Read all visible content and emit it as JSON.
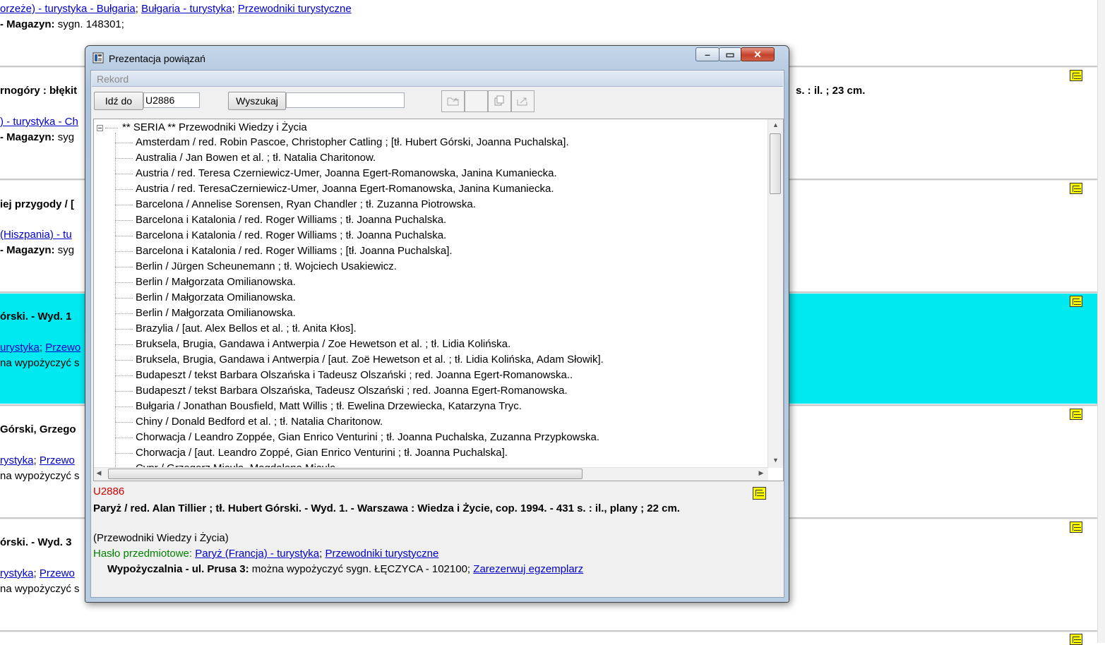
{
  "background": {
    "rows": [
      {
        "links": [
          "orzeże) - turystyka - Bułgaria",
          "Bułgaria - turystyka",
          "Przewodniki turystyczne"
        ],
        "holdings_label": "- Magazyn:",
        "holdings_value": "sygn. 148301;"
      },
      {
        "title": "rnogóry : błękit",
        "title_right": "s. : il. ; 23 cm.",
        "link": ") - turystyka - Ch",
        "holdings_label": "- Magazyn:",
        "holdings_value": "syg"
      },
      {
        "title": "iej przygody / [",
        "link": "(Hiszpania) - tu",
        "holdings_label": "- Magazyn:",
        "holdings_value": "syg"
      },
      {
        "title": "órski. - Wyd. 1",
        "link1": "urystyka",
        "link2": "Przewo",
        "avail": "na wypożyczyć s"
      },
      {
        "title": "Górski, Grzego",
        "link1": "rystyka",
        "link2": "Przewo",
        "avail": "na wypożyczyć s"
      },
      {
        "title": "órski. - Wyd. 3",
        "link1": "rystyka",
        "link2": "Przewo",
        "avail": "na wypożyczyć s"
      }
    ]
  },
  "dialog": {
    "title": "Prezentacja powiązań",
    "section_header": "Rekord",
    "goto_button": "Idź do",
    "goto_value": "U2886",
    "search_button": "Wyszukaj",
    "search_value": "",
    "tree_root": "** SERIA ** Przewodniki Wiedzy i Życia",
    "tree_items": [
      "Amsterdam / red. Robin Pascoe, Christopher Catling ; [tł. Hubert Górski, Joanna Puchalska].",
      "Australia / Jan Bowen et al. ; tł. Natalia Charitonow.",
      "Austria / red. Teresa Czerniewicz-Umer, Joanna Egert-Romanowska, Janina Kumaniecka.",
      "Austria / red. TeresaCzerniewicz-Umer, Joanna Egert-Romanowska, Janina Kumaniecka.",
      "Barcelona / Annelise Sorensen, Ryan Chandler ; tł. Zuzanna Piotrowska.",
      "Barcelona i Katalonia / red. Roger Williams ; tł. Joanna Puchalska.",
      "Barcelona i Katalonia / red. Roger Williams ; tł. Joanna Puchalska.",
      "Barcelona i Katalonia / red. Roger Williams ; [tł. Joanna Puchalska].",
      "Berlin / Jürgen Scheunemann ; tł. Wojciech Usakiewicz.",
      "Berlin / Małgorzata Omilianowska.",
      "Berlin / Małgorzata Omilianowska.",
      "Berlin / Małgorzata Omilianowska.",
      "Brazylia / [aut. Alex Bellos et al. ; tł. Anita Kłos].",
      "Bruksela, Brugia, Gandawa i Antwerpia / Zoe Hewetson et al. ; tł. Lidia Kolińska.",
      "Bruksela, Brugia, Gandawa i Antwerpia / [aut. Zoë Hewetson et al. ; tł. Lidia Kolińska, Adam Słowik].",
      "Budapeszt / tekst Barbara Olszańska i Tadeusz Olszański ; red. Joanna Egert-Romanowska..",
      "Budapeszt / tekst Barbara Olszańska, Tadeusz Olszański ; red. Joanna Egert-Romanowska.",
      "Bułgaria / Jonathan Bousfield, Matt Willis ; tł. Ewelina Drzewiecka, Katarzyna Tryc.",
      "Chiny / Donald Bedford et al. ; tł. Natalia Charitonow.",
      "Chorwacja / Leandro Zoppée, Gian Enrico Venturini ; tł. Joanna Puchalska, Zuzanna Przypkowska.",
      "Chorwacja / [aut. Leandro Zoppé, Gian Enrico Venturini ; tł. Joanna Puchalska].",
      "Cypr / Grzegorz Micuła, Magdalena Micuła"
    ],
    "detail": {
      "record_id": "U2886",
      "title": "Paryż / red. Alan Tillier ; tł. Hubert Górski. - Wyd. 1. - Warszawa : Wiedza i Życie, cop. 1994. - 431 s. : il., plany ; 22 cm.",
      "series": "(Przewodniki Wiedzy i Życia)",
      "subject_label": "Hasło przedmiotowe:",
      "subject_link1": "Paryż (Francja) - turystyka",
      "subject_link2": "Przewodniki turystyczne",
      "branch": "Wypożyczalnia - ul. Prusa 3:",
      "availability": "można wypożyczyć sygn. ŁĘCZYCA - 102100;",
      "reserve_link": "Zarezerwuj egzemplarz"
    }
  }
}
